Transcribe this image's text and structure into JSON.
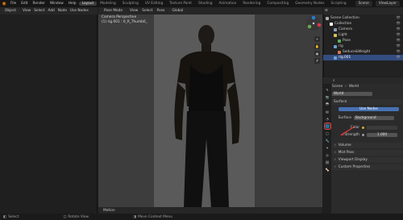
{
  "topbar": {
    "menus": [
      "File",
      "Edit",
      "Render",
      "Window",
      "Help"
    ],
    "workspaces": [
      "Layout",
      "Modeling",
      "Sculpting",
      "UV Editing",
      "Texture Paint",
      "Shading",
      "Animation",
      "Rendering",
      "Compositing",
      "Geometry Nodes",
      "Scripting"
    ],
    "active_workspace": "Layout",
    "scene": "Scene",
    "view_layer": "ViewLayer"
  },
  "left_editor": {
    "mode": "Object",
    "menus": [
      "View",
      "Select",
      "Add",
      "Node"
    ],
    "use_nodes_label": "Use Nodes"
  },
  "viewport": {
    "header": [
      "Pose Mode",
      "View",
      "Select",
      "Pose"
    ],
    "transform": "Global",
    "camera_label": "Camera Perspective",
    "collection_label": "(1) rig.001 : 0_R_Thumb0_",
    "timeline_label": "Motion"
  },
  "outliner": {
    "rows": [
      {
        "label": "Scene Collection",
        "indent": 0,
        "color": "#b0b0b0",
        "selected": false
      },
      {
        "label": "Collection",
        "indent": 1,
        "color": "#ffffff",
        "selected": false
      },
      {
        "label": "Camera",
        "indent": 2,
        "color": "#8a9cba",
        "selected": false
      },
      {
        "label": "Light",
        "indent": 2,
        "color": "#d8c15a",
        "selected": false
      },
      {
        "label": "Pose",
        "indent": 3,
        "color": "#5db05d",
        "selected": false
      },
      {
        "label": "rig",
        "indent": 2,
        "color": "#6fa0d0",
        "selected": false
      },
      {
        "label": "Seduce&Weight",
        "indent": 3,
        "color": "#d07a4f",
        "selected": false
      },
      {
        "label": "rig.001",
        "indent": 2,
        "color": "#6fa0d0",
        "selected": true
      }
    ]
  },
  "properties": {
    "scene": "Scene",
    "world_tab": "World",
    "world_name": "World",
    "surface_panel": "Surface",
    "use_nodes": "Use Nodes",
    "surface_label": "Surface",
    "surface_value": "Background",
    "color_label": "Color",
    "strength_label": "Strength",
    "strength_value": "1.000",
    "panels": [
      "Volume",
      "Mist Pass",
      "Viewport Display",
      "Custom Properties"
    ]
  },
  "statusbar": {
    "left": "Select",
    "middle": "Rotate View",
    "right": "Move Context Menu"
  },
  "colors": {
    "accent_blue": "#4772b3",
    "highlight_red": "#e23a3a",
    "blender_orange": "#e87d0d"
  }
}
